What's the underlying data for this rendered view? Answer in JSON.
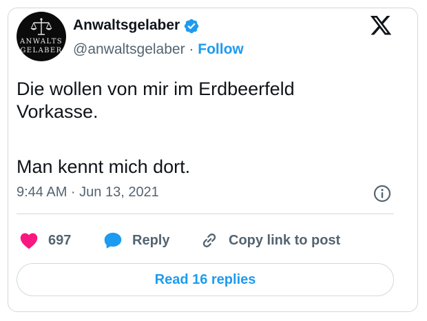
{
  "author": {
    "name": "Anwaltsgelaber",
    "handle": "@anwaltsgelaber",
    "separator": "·",
    "follow_label": "Follow",
    "avatar_text_line1": "ANWALTS",
    "avatar_text_line2": "GELABER",
    "verified": true,
    "verified_icon": "verified-badge-icon"
  },
  "platform_logo": "x-logo-icon",
  "tweet": {
    "lines": [
      "Die wollen von mir im Erdbeerfeld",
      "Vorkasse."
    ],
    "line2": "Man kennt mich dort.",
    "timestamp": "9:44 AM · Jun 13, 2021"
  },
  "actions": {
    "like_count": "697",
    "reply_label": "Reply",
    "copy_label": "Copy link to post"
  },
  "read_replies_label": "Read 16 replies",
  "colors": {
    "accent": "#1d9bf0",
    "like": "#f91880",
    "text": "#0f1419",
    "secondary": "#536471",
    "border": "#cfd9de"
  }
}
